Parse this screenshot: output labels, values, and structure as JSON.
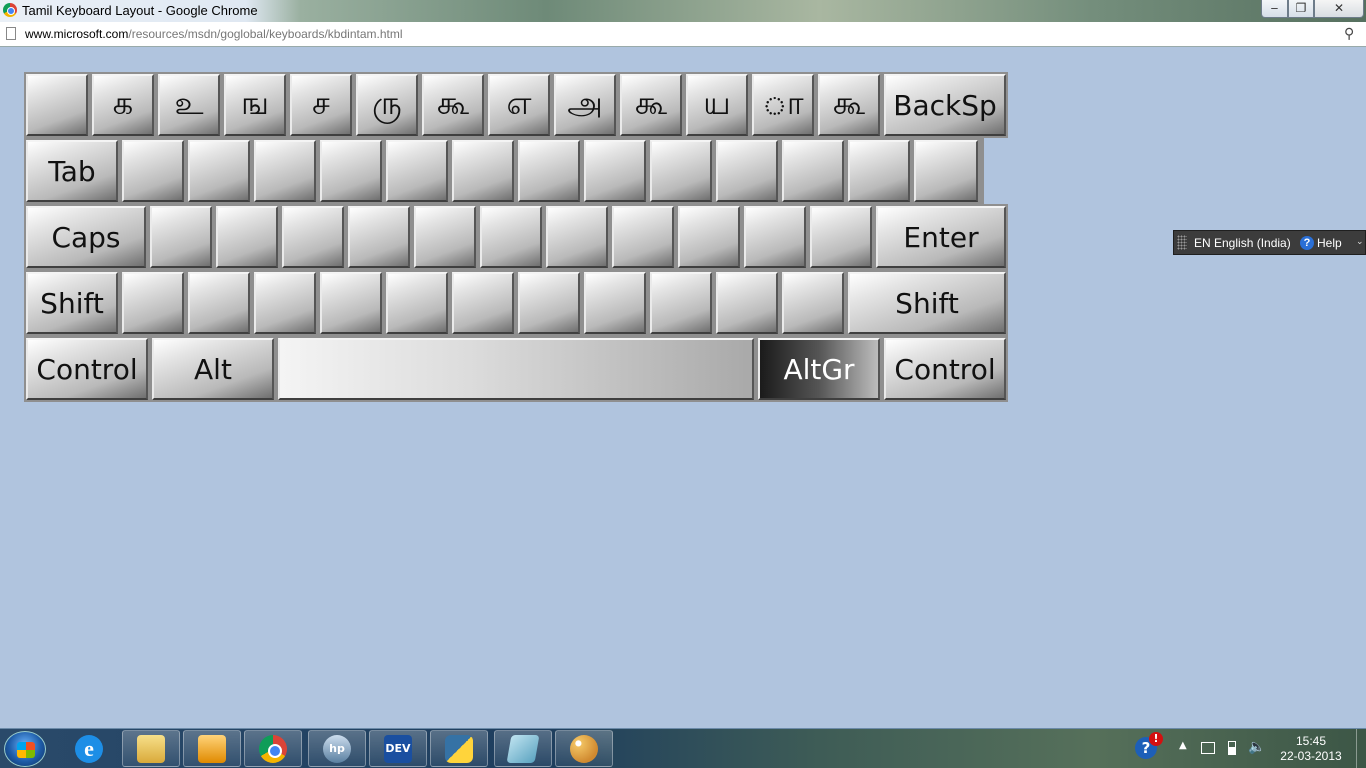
{
  "window": {
    "title": "Tamil Keyboard Layout - Google Chrome",
    "minimize_glyph": "‒",
    "maximize_glyph": "❐",
    "close_glyph": "✕"
  },
  "address": {
    "host": "www.microsoft.com",
    "path": "/resources/msdn/goglobal/keyboards/kbdintam.html",
    "zoom_glyph": "⚲"
  },
  "keyboard": {
    "row1": [
      "",
      "க",
      "உ",
      "ங",
      "ச",
      "ரு",
      "கூ",
      "எ",
      "அ",
      "கூ",
      "ய",
      "ா",
      "கூ",
      "BackSp"
    ],
    "row2": [
      "Tab",
      "",
      "",
      "",
      "",
      "",
      "",
      "",
      "",
      "",
      "",
      "",
      "",
      ""
    ],
    "row3": [
      "Caps",
      "",
      "",
      "",
      "",
      "",
      "",
      "",
      "",
      "",
      "",
      "",
      "Enter"
    ],
    "row4": [
      "Shift",
      "",
      "",
      "",
      "",
      "",
      "",
      "",
      "",
      "",
      "",
      "Shift"
    ],
    "row5": [
      "Control",
      "Alt",
      "",
      "AltGr",
      "Control"
    ]
  },
  "langbar": {
    "language": "EN English (India)",
    "help_icon": "?",
    "help": "Help",
    "options_glyph": "⌄"
  },
  "taskbar": {
    "icons": [
      "start-icon",
      "ie-icon",
      "folder-icon",
      "media-player-icon",
      "chrome-icon",
      "hp-icon",
      "devcpp-icon",
      "python-icon",
      "notepad-icon",
      "paint-icon"
    ],
    "dev_label": "DEV",
    "hp_label": "hp",
    "ie_label": "e",
    "tray_help": "?",
    "tray_alert": "!",
    "tray_arrow": "▲",
    "volume_glyph": "🔈",
    "time": "15:45",
    "date": "22-03-2013"
  }
}
